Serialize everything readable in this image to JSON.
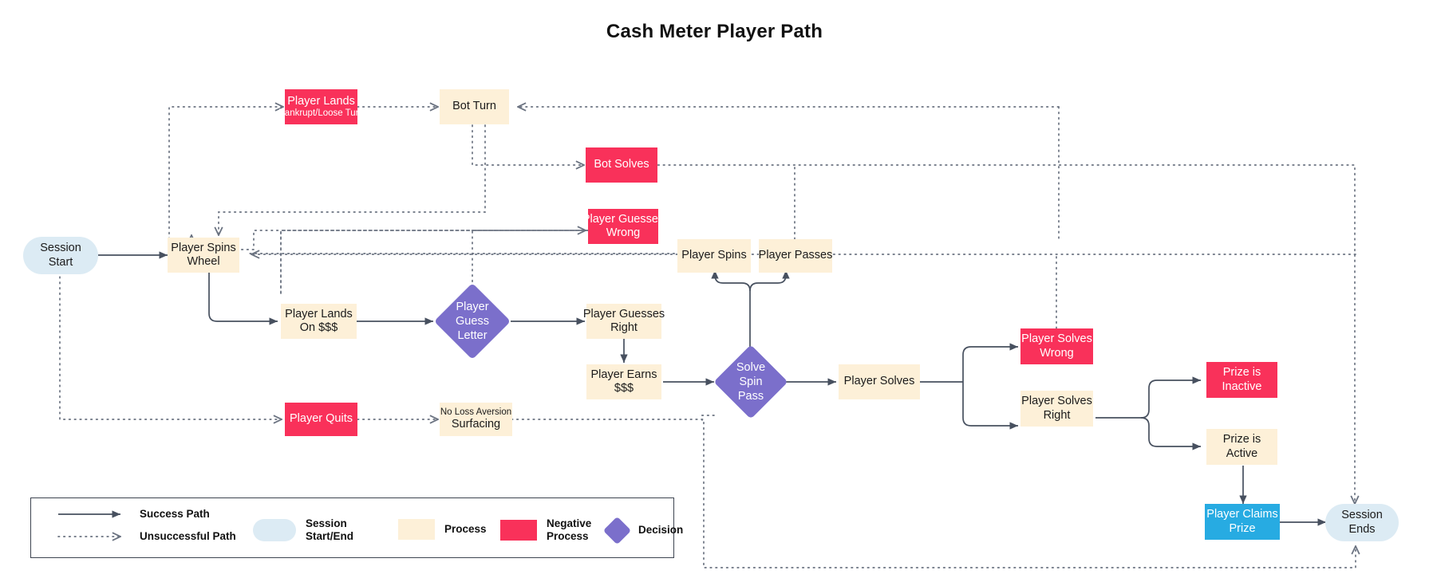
{
  "title": "Cash Meter Player Path",
  "colors": {
    "process": "#FDF0D8",
    "negative": "#F9315A",
    "decision": "#7B6FCB",
    "terminal": "#DCEBF4",
    "claim": "#27ABE2",
    "edge": "#47505F"
  },
  "nodes": {
    "session_start": {
      "l1": "Session",
      "l2": "Start"
    },
    "player_spins_wheel": {
      "l1": "Player Spins",
      "l2": "Wheel"
    },
    "player_lands_bankrupt": {
      "l1": "Player Lands",
      "l2": "Bankrupt/Loose Turn"
    },
    "bot_turn": {
      "l1": "Bot Turn",
      "l2": ""
    },
    "bot_solves": {
      "l1": "Bot Solves",
      "l2": ""
    },
    "player_guesses_wrong": {
      "l1": "Player Guesses",
      "l2": "Wrong"
    },
    "player_lands_on_money": {
      "l1": "Player Lands",
      "l2": "On $$$"
    },
    "player_guess_letter": {
      "l1": "Player",
      "l2": "Guess",
      "l3": "Letter"
    },
    "player_guesses_right": {
      "l1": "Player Guesses",
      "l2": "Right"
    },
    "player_earns_money": {
      "l1": "Player Earns",
      "l2": "$$$"
    },
    "player_spins": {
      "l1": "Player Spins",
      "l2": ""
    },
    "player_passes": {
      "l1": "Player Passes",
      "l2": ""
    },
    "solve_spin_pass": {
      "l1": "Solve",
      "l2": "Spin",
      "l3": "Pass"
    },
    "player_solves": {
      "l1": "Player Solves",
      "l2": ""
    },
    "player_solves_wrong": {
      "l1": "Player Solves",
      "l2": "Wrong"
    },
    "player_solves_right": {
      "l1": "Player Solves",
      "l2": "Right"
    },
    "prize_is_inactive": {
      "l1": "Prize is",
      "l2": "Inactive"
    },
    "prize_is_active": {
      "l1": "Prize is",
      "l2": "Active"
    },
    "player_claims_prize": {
      "l1": "Player Claims",
      "l2": "Prize"
    },
    "session_ends": {
      "l1": "Session",
      "l2": "Ends"
    },
    "player_quits": {
      "l1": "Player Quits",
      "l2": ""
    },
    "no_loss_aversion": {
      "l1": "No Loss Aversion",
      "l2": "Surfacing"
    }
  },
  "legend": {
    "success_path": "Success Path",
    "unsuccessful_path": "Unsuccessful Path",
    "session_start_end_1": "Session",
    "session_start_end_2": "Start/End",
    "process": "Process",
    "negative_process_1": "Negative",
    "negative_process_2": "Process",
    "decision": "Decision"
  }
}
